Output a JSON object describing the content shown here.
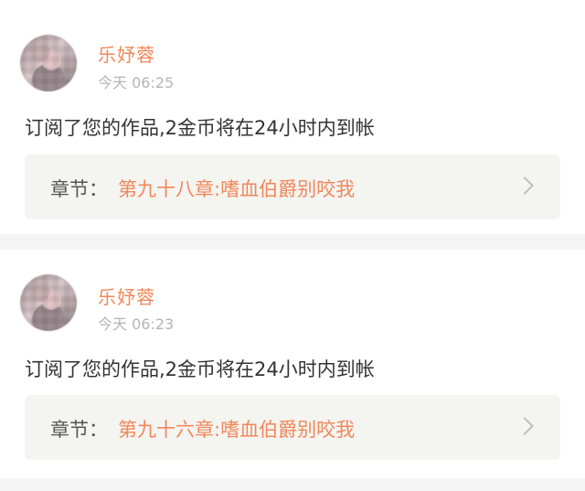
{
  "colors": {
    "accent": "#f0885a",
    "tab_indicator": "#f06b9a",
    "card_bg": "#ffffff",
    "page_bg": "#f5f5f5",
    "chapter_bg": "#f4f4f1"
  },
  "notifications": [
    {
      "user": "乐妤蓉",
      "time": "今天 06:25",
      "message": "订阅了您的作品,2金币将在24小时内到帐",
      "chapter_prefix": "章节：",
      "chapter_title": "第九十八章:嗜血伯爵别咬我",
      "icon": "chevron-right-icon"
    },
    {
      "user": "乐妤蓉",
      "time": "今天 06:23",
      "message": "订阅了您的作品,2金币将在24小时内到帐",
      "chapter_prefix": "章节：",
      "chapter_title": "第九十六章:嗜血伯爵别咬我",
      "icon": "chevron-right-icon"
    }
  ]
}
